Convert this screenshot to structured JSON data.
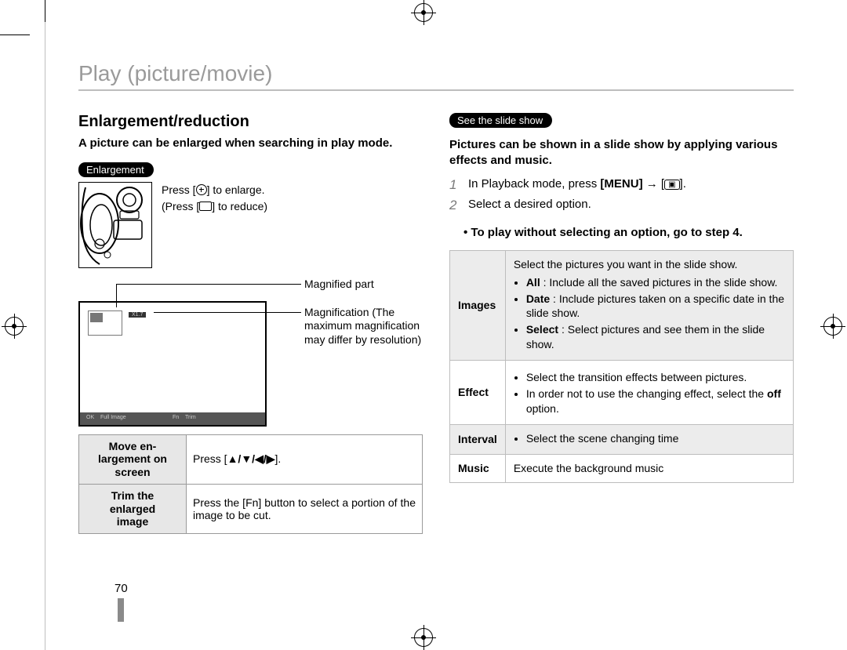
{
  "page_number": "70",
  "page_title": "Play (picture/movie)",
  "left": {
    "section_title": "Enlargement/reduction",
    "intro": "A picture can be enlarged when searching in play mode.",
    "pill": "Enlargement",
    "enlarge_line1_a": "Press [",
    "enlarge_line1_b": "] to enlarge.",
    "reduce_line_a": "(Press [",
    "reduce_line_b": "] to reduce)",
    "magnified_label": "Magnified part",
    "magnification_label": "Magnification (The maximum magnification may differ by resolution)",
    "viewer_mag": "X1.7",
    "viewer_ok": "OK",
    "viewer_full": "Full Image",
    "viewer_fn": "Fn",
    "viewer_trim": "Trim",
    "table": {
      "r1_key": "Move en-\nlargement on\nscreen",
      "r1_val_a": "Press [",
      "r1_val_b": "].",
      "r1_arrows": "▲/▼/◀/▶",
      "r2_key": "Trim the\nenlarged\nimage",
      "r2_val": "Press the [Fn] button to select a portion of the image to be cut."
    }
  },
  "right": {
    "pill": "See the slide show",
    "intro": "Pictures can be shown in a slide show by applying various effects and music.",
    "step1_a": "In Playback mode, press ",
    "step1_menu": "[MENU]",
    "step1_b": " → [",
    "step1_c": "].",
    "step2": "Select a desired option.",
    "sub_bullet_a": "To play without selecting an option, go to ",
    "sub_bullet_b": "step 4",
    "sub_bullet_c": ".",
    "options": {
      "images_key": "Images",
      "images_lead": "Select the pictures you want in the slide show.",
      "images_all_key": "All",
      "images_all_val": " : Include all the saved pictures in the slide show.",
      "images_date_key": "Date",
      "images_date_val": " : Include pictures taken on a specific date in the slide show.",
      "images_select_key": "Select",
      "images_select_val": " : Select pictures and see them in the slide show.",
      "effect_key": "Effect",
      "effect_b1": "Select the transition effects between pictures.",
      "effect_b2_a": "In order not to use the changing effect, select the ",
      "effect_b2_off": "off",
      "effect_b2_b": " option.",
      "interval_key": "Interval",
      "interval_val": "Select the scene changing time",
      "music_key": "Music",
      "music_val": "Execute the background music"
    }
  }
}
